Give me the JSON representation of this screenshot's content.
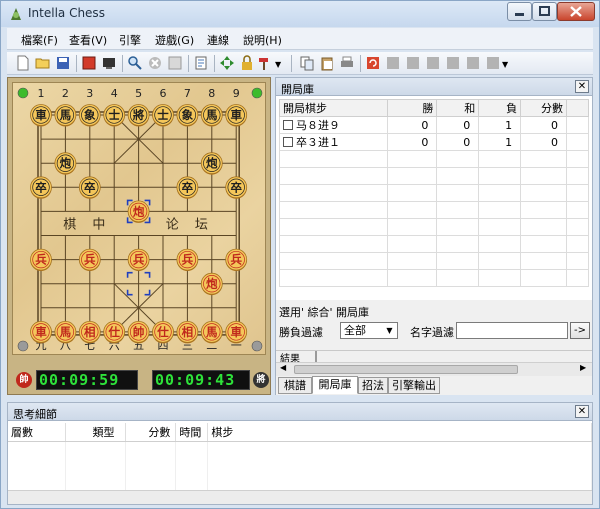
{
  "window": {
    "title": "Intella Chess"
  },
  "menu": [
    {
      "id": "file",
      "label": "檔案(F)"
    },
    {
      "id": "view",
      "label": "查看(V)"
    },
    {
      "id": "engine",
      "label": "引擎"
    },
    {
      "id": "game",
      "label": "遊戲(G)"
    },
    {
      "id": "connect",
      "label": "連線"
    },
    {
      "id": "help",
      "label": "說明(H)"
    }
  ],
  "board": {
    "top_files": [
      "1",
      "2",
      "3",
      "4",
      "5",
      "6",
      "7",
      "8",
      "9"
    ],
    "bottom_files": [
      "九",
      "八",
      "七",
      "六",
      "五",
      "四",
      "三",
      "二",
      "一"
    ],
    "river_left": "棋 中",
    "river_right": "论 坛",
    "pieces": [
      {
        "char": "車",
        "color": "black",
        "file": 0,
        "rank": 0
      },
      {
        "char": "馬",
        "color": "black",
        "file": 1,
        "rank": 0
      },
      {
        "char": "象",
        "color": "black",
        "file": 2,
        "rank": 0
      },
      {
        "char": "士",
        "color": "black",
        "file": 3,
        "rank": 0
      },
      {
        "char": "將",
        "color": "black",
        "file": 4,
        "rank": 0
      },
      {
        "char": "士",
        "color": "black",
        "file": 5,
        "rank": 0
      },
      {
        "char": "象",
        "color": "black",
        "file": 6,
        "rank": 0
      },
      {
        "char": "馬",
        "color": "black",
        "file": 7,
        "rank": 0
      },
      {
        "char": "車",
        "color": "black",
        "file": 8,
        "rank": 0
      },
      {
        "char": "炮",
        "color": "black",
        "file": 1,
        "rank": 2
      },
      {
        "char": "炮",
        "color": "black",
        "file": 7,
        "rank": 2
      },
      {
        "char": "卒",
        "color": "black",
        "file": 0,
        "rank": 3
      },
      {
        "char": "卒",
        "color": "black",
        "file": 2,
        "rank": 3
      },
      {
        "char": "卒",
        "color": "black",
        "file": 6,
        "rank": 3
      },
      {
        "char": "卒",
        "color": "black",
        "file": 8,
        "rank": 3
      },
      {
        "char": "炮",
        "color": "red",
        "file": 4,
        "rank": 4
      },
      {
        "char": "兵",
        "color": "red",
        "file": 0,
        "rank": 6
      },
      {
        "char": "兵",
        "color": "red",
        "file": 2,
        "rank": 6
      },
      {
        "char": "兵",
        "color": "red",
        "file": 4,
        "rank": 6
      },
      {
        "char": "兵",
        "color": "red",
        "file": 6,
        "rank": 6
      },
      {
        "char": "兵",
        "color": "red",
        "file": 8,
        "rank": 6
      },
      {
        "char": "炮",
        "color": "red",
        "file": 7,
        "rank": 7
      },
      {
        "char": "車",
        "color": "red",
        "file": 0,
        "rank": 9
      },
      {
        "char": "馬",
        "color": "red",
        "file": 1,
        "rank": 9
      },
      {
        "char": "相",
        "color": "red",
        "file": 2,
        "rank": 9
      },
      {
        "char": "仕",
        "color": "red",
        "file": 3,
        "rank": 9
      },
      {
        "char": "帥",
        "color": "red",
        "file": 4,
        "rank": 9
      },
      {
        "char": "仕",
        "color": "red",
        "file": 5,
        "rank": 9
      },
      {
        "char": "相",
        "color": "red",
        "file": 6,
        "rank": 9
      },
      {
        "char": "馬",
        "color": "red",
        "file": 7,
        "rank": 9
      },
      {
        "char": "車",
        "color": "red",
        "file": 8,
        "rank": 9
      }
    ],
    "last_move_from": {
      "file": 4,
      "rank": 7
    },
    "last_move_to": {
      "file": 4,
      "rank": 4
    },
    "colors": {
      "red": "#c0281c",
      "black": "#1f1f1f",
      "piece_face": "#f4c65a",
      "line": "#5a4524"
    }
  },
  "clocks": {
    "red_badge": "帥",
    "black_badge": "將",
    "red_time": "00:09:59",
    "black_time": "00:09:43"
  },
  "opening_panel": {
    "title": "開局庫",
    "columns": [
      "開局棋步",
      "勝",
      "和",
      "負",
      "分數"
    ],
    "rows": [
      {
        "move": "马８进９",
        "win": "0",
        "draw": "0",
        "loss": "1",
        "score": "0"
      },
      {
        "move": "卒３进１",
        "win": "0",
        "draw": "0",
        "loss": "1",
        "score": "0"
      }
    ],
    "use_label": "選用' 綜合' 開局庫",
    "win_filter_label": "勝負過濾",
    "win_filter_value": "全部",
    "name_filter_label": "名字過濾",
    "go_button": "->",
    "results_label": "結果",
    "tabs": [
      "棋譜",
      "開局庫",
      "招法",
      "引擎輸出"
    ]
  },
  "think_panel": {
    "title": "思考細節",
    "columns": [
      "層數",
      "類型",
      "分數",
      "時間",
      "棋步"
    ]
  }
}
